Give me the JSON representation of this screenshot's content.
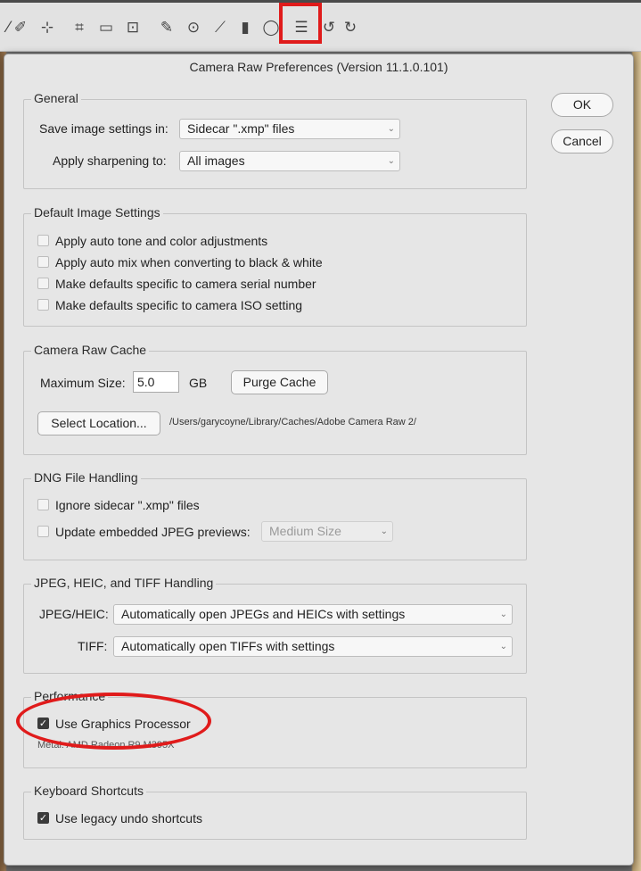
{
  "dialog": {
    "title": "Camera Raw Preferences  (Version 11.1.0.101)",
    "ok_label": "OK",
    "cancel_label": "Cancel"
  },
  "general": {
    "legend": "General",
    "save_settings_label": "Save image settings in:",
    "save_settings_value": "Sidecar \".xmp\" files",
    "sharpening_label": "Apply sharpening to:",
    "sharpening_value": "All images"
  },
  "default_image_settings": {
    "legend": "Default Image Settings",
    "options": [
      {
        "label": "Apply auto tone and color adjustments",
        "checked": false
      },
      {
        "label": "Apply auto mix when converting to black & white",
        "checked": false
      },
      {
        "label": "Make defaults specific to camera serial number",
        "checked": false
      },
      {
        "label": "Make defaults specific to camera ISO setting",
        "checked": false
      }
    ]
  },
  "cache": {
    "legend": "Camera Raw Cache",
    "max_size_label": "Maximum Size:",
    "max_size_value": "5.0",
    "unit": "GB",
    "purge_label": "Purge Cache",
    "select_location_label": "Select Location...",
    "path": "/Users/garycoyne/Library/Caches/Adobe Camera Raw 2/"
  },
  "dng": {
    "legend": "DNG File Handling",
    "ignore_sidecar_label": "Ignore sidecar \".xmp\" files",
    "ignore_sidecar_checked": false,
    "update_previews_label": "Update embedded JPEG previews:",
    "update_previews_checked": false,
    "preview_size_value": "Medium Size"
  },
  "jpeg_tiff": {
    "legend": "JPEG, HEIC, and TIFF Handling",
    "jpeg_label": "JPEG/HEIC:",
    "jpeg_value": "Automatically open JPEGs and HEICs with settings",
    "tiff_label": "TIFF:",
    "tiff_value": "Automatically open TIFFs with settings"
  },
  "performance": {
    "legend": "Performance",
    "gpu_label": "Use Graphics Processor",
    "gpu_checked": true,
    "gpu_info": "Metal: AMD Radeon R9 M395X"
  },
  "shortcuts": {
    "legend": "Keyboard Shortcuts",
    "legacy_undo_label": "Use legacy undo shortcuts",
    "legacy_undo_checked": true
  },
  "toolbar": {
    "tools": [
      "white-balance-icon",
      "color-sampler-icon",
      "targeted-adjustment-icon",
      "crop-icon",
      "straighten-icon",
      "transform-icon",
      "spot-removal-icon",
      "red-eye-icon",
      "adjustment-brush-icon",
      "graduated-filter-icon",
      "radial-filter-icon",
      "preferences-icon",
      "rotate-left-icon",
      "rotate-right-icon"
    ],
    "glyphs": [
      "⁄",
      "✐",
      "⊹",
      "⌗",
      "▭",
      "⊡",
      "✎",
      "⊙",
      "⟋",
      "▮",
      "◯",
      "☰",
      "↺",
      "↻"
    ]
  },
  "colors": {
    "annotation_red": "#e01b1b",
    "dialog_bg": "#e6e6e6"
  }
}
